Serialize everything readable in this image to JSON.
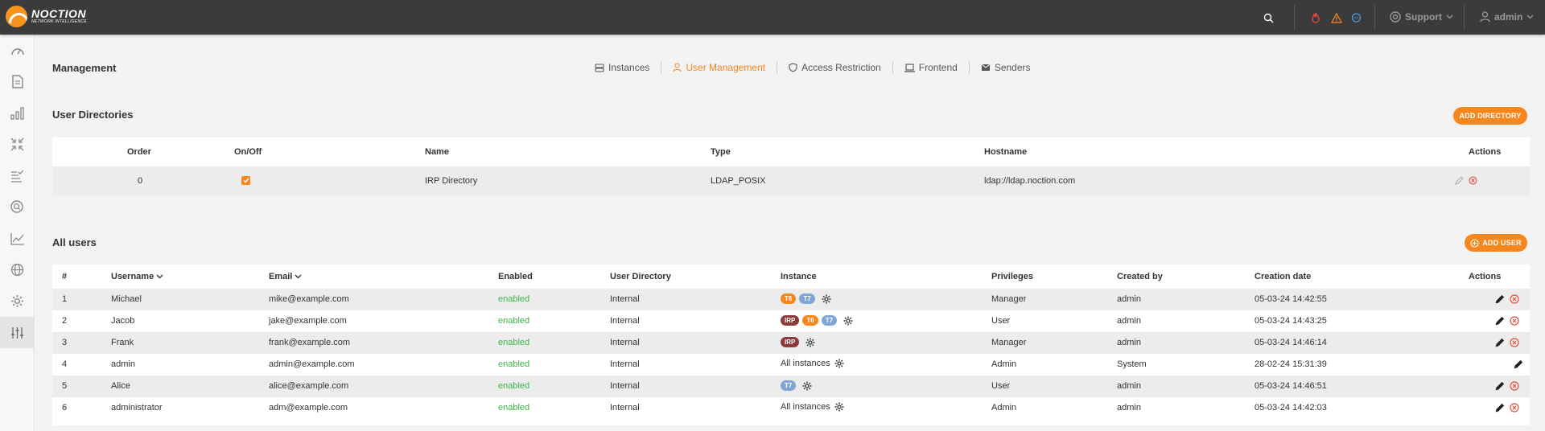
{
  "header": {
    "brand": "NOCTION",
    "brand_sub": "NETWORK INTELLIGENCE",
    "support_label": "Support",
    "user_label": "admin"
  },
  "sidebar": {
    "items": [
      "dashboard-icon",
      "reports-icon",
      "bar-chart-icon",
      "collapse-arrows-icon",
      "checklist-icon",
      "search-circle-icon",
      "line-chart-icon",
      "globe-icon",
      "settings-gear-icon",
      "sliders-icon"
    ],
    "active_index": 9
  },
  "page": {
    "title": "Management",
    "tabs": [
      {
        "label": "Instances",
        "icon": "server-icon"
      },
      {
        "label": "User Management",
        "icon": "user-icon"
      },
      {
        "label": "Access Restriction",
        "icon": "shield-icon"
      },
      {
        "label": "Frontend",
        "icon": "laptop-icon"
      },
      {
        "label": "Senders",
        "icon": "envelope-icon"
      }
    ],
    "active_tab": 1
  },
  "directories": {
    "title": "User Directories",
    "add_button": "ADD DIRECTORY",
    "columns": {
      "order": "Order",
      "onoff": "On/Off",
      "name": "Name",
      "type": "Type",
      "hostname": "Hostname",
      "actions": "Actions"
    },
    "rows": [
      {
        "order": "0",
        "enabled": true,
        "name": "IRP Directory",
        "type": "LDAP_POSIX",
        "hostname": "ldap://ldap.noction.com"
      }
    ]
  },
  "users": {
    "title": "All users",
    "add_button": "ADD USER",
    "columns": {
      "num": "#",
      "username": "Username",
      "email": "Email",
      "enabled": "Enabled",
      "directory": "User Directory",
      "instance": "Instance",
      "privileges": "Privileges",
      "created_by": "Created by",
      "creation_date": "Creation date",
      "actions": "Actions"
    },
    "rows": [
      {
        "num": "1",
        "username": "Michael",
        "email": "mike@example.com",
        "enabled": "enabled",
        "directory": "Internal",
        "badges": [
          "T6",
          "T7"
        ],
        "instance_text": "",
        "privileges": "Manager",
        "created_by": "admin",
        "date": "05-03-24 14:42:55",
        "deletable": true
      },
      {
        "num": "2",
        "username": "Jacob",
        "email": "jake@example.com",
        "enabled": "enabled",
        "directory": "Internal",
        "badges": [
          "IRP",
          "T6",
          "T7"
        ],
        "instance_text": "",
        "privileges": "User",
        "created_by": "admin",
        "date": "05-03-24 14:43:25",
        "deletable": true
      },
      {
        "num": "3",
        "username": "Frank",
        "email": "frank@example.com",
        "enabled": "enabled",
        "directory": "Internal",
        "badges": [
          "IRP"
        ],
        "instance_text": "",
        "privileges": "Manager",
        "created_by": "admin",
        "date": "05-03-24 14:46:14",
        "deletable": true
      },
      {
        "num": "4",
        "username": "admin",
        "email": "admin@example.com",
        "enabled": "enabled",
        "directory": "Internal",
        "badges": [],
        "instance_text": "All instances",
        "privileges": "Admin",
        "created_by": "System",
        "date": "28-02-24 15:31:39",
        "deletable": false
      },
      {
        "num": "5",
        "username": "Alice",
        "email": "alice@example.com",
        "enabled": "enabled",
        "directory": "Internal",
        "badges": [
          "T7"
        ],
        "instance_text": "",
        "privileges": "User",
        "created_by": "admin",
        "date": "05-03-24 14:46:51",
        "deletable": true
      },
      {
        "num": "6",
        "username": "administrator",
        "email": "adm@example.com",
        "enabled": "enabled",
        "directory": "Internal",
        "badges": [],
        "instance_text": "All instances",
        "privileges": "Admin",
        "created_by": "admin",
        "date": "05-03-24 14:42:03",
        "deletable": true
      }
    ]
  },
  "colors": {
    "accent": "#f7861d",
    "enabled": "#3cb54a",
    "topbar": "#3b3b3b",
    "delete": "#e74c3c"
  }
}
